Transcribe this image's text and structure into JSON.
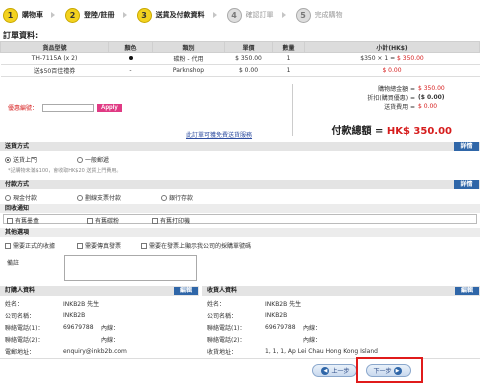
{
  "steps": [
    {
      "num": "1",
      "label": "購物車",
      "state": "active"
    },
    {
      "num": "2",
      "label": "登陸/註冊",
      "state": "active"
    },
    {
      "num": "3",
      "label": "送貨及付款資料",
      "state": "active"
    },
    {
      "num": "4",
      "label": "確認訂單",
      "state": "inactive"
    },
    {
      "num": "5",
      "label": "完成購物",
      "state": "inactive"
    }
  ],
  "order": {
    "title": "訂單資料:",
    "headers": [
      "貨品型號",
      "顏色",
      "類別",
      "單價",
      "數量",
      "小計(HK$)"
    ],
    "rows": [
      {
        "model": "TH-7115A (x 2)",
        "color_mark": "●",
        "category": "碳粉 - 代用",
        "unit_price": "$ 350.00",
        "qty": "1",
        "subtotal_formula": "$350 × 1 = ",
        "subtotal": "$ 350.00"
      },
      {
        "model": "送$50百佳禮券",
        "color_mark": "-",
        "category": "Parknshop",
        "unit_price": "$ 0.00",
        "qty": "1",
        "subtotal_formula": "",
        "subtotal": "$ 0.00"
      }
    ],
    "summary": [
      {
        "label": "購物總金額 = ",
        "value": "$ 350.00"
      },
      {
        "label": "折扣(購買優惠) = ",
        "value": "($ 0.00)"
      },
      {
        "label": "送貨費用 = ",
        "value": "$ 0.00"
      }
    ],
    "total_label": "付款總額 = ",
    "total_value": "HK$ 350.00",
    "coupon_label": "優惠編號：",
    "coupon_placeholder": "",
    "apply_label": "Apply",
    "note_link": "此訂單可獲免費送貨服務"
  },
  "shipping": {
    "title": "送貨方式",
    "detail": "詳情",
    "options": [
      "送貨上門",
      "一般郵遞"
    ],
    "note": "*記購物未滿$100，會收取HK$20 送貨上門費用。"
  },
  "payment": {
    "title": "付款方式",
    "detail": "詳情",
    "options": [
      "現金付款",
      "劃線支票付款",
      "銀行存款"
    ]
  },
  "notify": {
    "title": "回收通知",
    "options": [
      "有舊墨盒",
      "有舊碳粉",
      "有舊打印機"
    ]
  },
  "other": {
    "title": "其他選項",
    "options": [
      "需要正式的收據",
      "需要傳真發票",
      "需要在發票上顯示我公司的採購單號碼"
    ],
    "remarks_label": "備註"
  },
  "orderer": {
    "title": "訂購人資料",
    "edit": "編輯",
    "fields": [
      {
        "label": "姓名：",
        "value": "INKB2B  先生",
        "extra": ""
      },
      {
        "label": "公司名稱：",
        "value": "INKB2B",
        "extra": ""
      },
      {
        "label": "聯絡電話(1)：",
        "value": "69679788",
        "extra": "內線："
      },
      {
        "label": "聯絡電話(2)：",
        "value": "",
        "extra": "內線："
      },
      {
        "label": "電郵地址：",
        "value": "enquiry@inkb2b.com",
        "extra": ""
      }
    ]
  },
  "receiver": {
    "title": "收貨人資料",
    "edit": "編輯",
    "fields": [
      {
        "label": "姓名：",
        "value": "INKB2B  先生",
        "extra": ""
      },
      {
        "label": "公司名稱：",
        "value": "INKB2B",
        "extra": ""
      },
      {
        "label": "聯絡電話(1)：",
        "value": "69679788",
        "extra": "內線："
      },
      {
        "label": "聯絡電話(2)：",
        "value": "",
        "extra": "內線："
      },
      {
        "label": "收貨地址：",
        "value": "1, 1, 1, Ap Lei Chau Hong Kong Island",
        "extra": ""
      }
    ]
  },
  "nav": {
    "prev": "上一步",
    "next": "下一步"
  }
}
